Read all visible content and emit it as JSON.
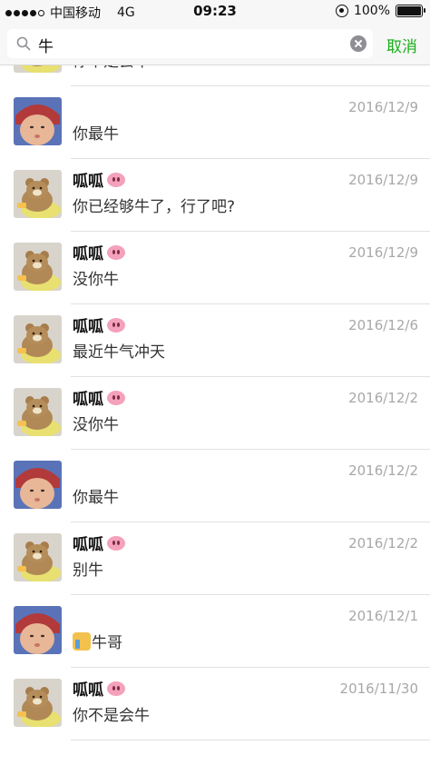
{
  "status_bar": {
    "carrier": "中国移动",
    "network": "4G",
    "time": "09:23",
    "battery": "100%",
    "signal_level": 0.8
  },
  "search": {
    "query": "牛",
    "cancel_label": "取消"
  },
  "colors": {
    "accent": "#1aad19",
    "date_gray": "#a8a8a8",
    "separator": "#e1e1e1"
  },
  "results": [
    {
      "avatar": "bear",
      "sender": "",
      "emoji": "",
      "date": "",
      "message": "你不是会牛",
      "thumb": false
    },
    {
      "avatar": "baby",
      "sender": "",
      "emoji": "",
      "date": "2016/12/9",
      "message": "你最牛",
      "thumb": false
    },
    {
      "avatar": "bear",
      "sender": "呱呱",
      "emoji": "pig-nose",
      "date": "2016/12/9",
      "message": "你已经够牛了，行了吧?",
      "thumb": false
    },
    {
      "avatar": "bear",
      "sender": "呱呱",
      "emoji": "pig-nose",
      "date": "2016/12/9",
      "message": "没你牛",
      "thumb": false
    },
    {
      "avatar": "bear",
      "sender": "呱呱",
      "emoji": "pig-nose",
      "date": "2016/12/6",
      "message": "最近牛气冲天",
      "thumb": false
    },
    {
      "avatar": "bear",
      "sender": "呱呱",
      "emoji": "pig-nose",
      "date": "2016/12/2",
      "message": "没你牛",
      "thumb": false
    },
    {
      "avatar": "baby",
      "sender": "",
      "emoji": "",
      "date": "2016/12/2",
      "message": "你最牛",
      "thumb": false
    },
    {
      "avatar": "bear",
      "sender": "呱呱",
      "emoji": "pig-nose",
      "date": "2016/12/2",
      "message": "别牛",
      "thumb": false
    },
    {
      "avatar": "baby",
      "sender": "",
      "emoji": "",
      "date": "2016/12/1",
      "message": "牛哥",
      "thumb": true
    },
    {
      "avatar": "bear",
      "sender": "呱呱",
      "emoji": "pig-nose",
      "date": "2016/11/30",
      "message": "你不是会牛",
      "thumb": false
    }
  ]
}
